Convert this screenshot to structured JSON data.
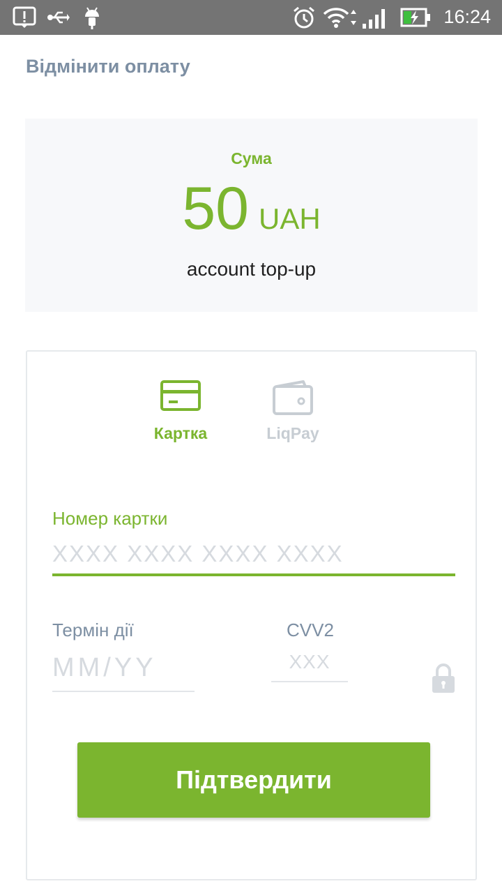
{
  "status_bar": {
    "time": "16:24",
    "icons": [
      "alert-icon",
      "usb-icon",
      "android-icon",
      "alarm-icon",
      "wifi-icon",
      "signal-icon",
      "battery-charging-icon"
    ]
  },
  "header": {
    "cancel_label": "Відмінити оплату"
  },
  "amount": {
    "label": "Сума",
    "value": "50",
    "currency": "UAH",
    "description": "account top-up"
  },
  "payment_methods": [
    {
      "label": "Картка",
      "icon": "credit-card-icon",
      "active": true
    },
    {
      "label": "LiqPay",
      "icon": "wallet-icon",
      "active": false
    }
  ],
  "form": {
    "card_number_label": "Номер картки",
    "card_number_placeholder": "XXXX XXXX XXXX XXXX",
    "expiry_label": "Термін дії",
    "expiry_placeholder": "MM/YY",
    "cvv_label": "CVV2",
    "cvv_placeholder": "XXX"
  },
  "confirm_label": "Підтвердити",
  "colors": {
    "accent": "#7bb52f",
    "muted_text": "#7d8fa3",
    "inactive": "#c7cdd3",
    "status_bar": "#747474"
  }
}
